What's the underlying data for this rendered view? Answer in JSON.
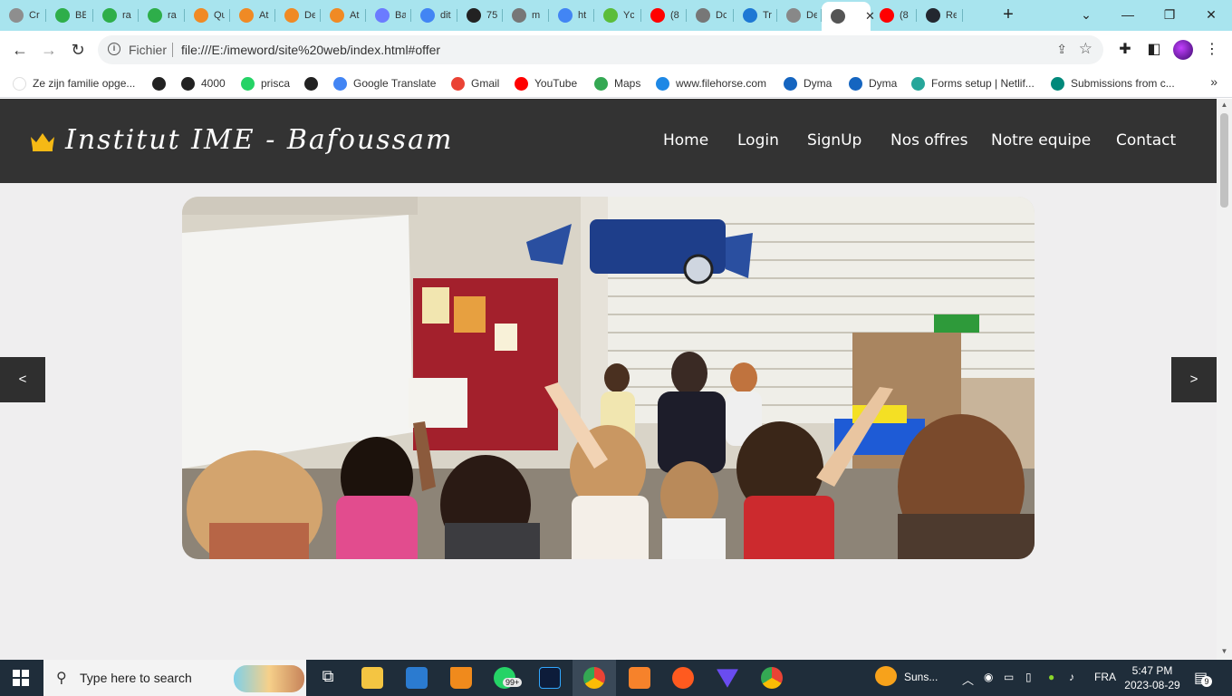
{
  "browser": {
    "tabs": [
      {
        "title": "Cr",
        "color": "#8e8e8e"
      },
      {
        "title": "BE",
        "color": "#2eae4a"
      },
      {
        "title": "ra",
        "color": "#2eae4a"
      },
      {
        "title": "ra",
        "color": "#2eae4a"
      },
      {
        "title": "Qu",
        "color": "#f08a24"
      },
      {
        "title": "At",
        "color": "#f08a24"
      },
      {
        "title": "De",
        "color": "#f08a24"
      },
      {
        "title": "At",
        "color": "#f08a24"
      },
      {
        "title": "Ba",
        "color": "#6b7bff"
      },
      {
        "title": "dit",
        "color": "#4285f4"
      },
      {
        "title": "75",
        "color": "#222222"
      },
      {
        "title": "m",
        "color": "#777777"
      },
      {
        "title": "ht",
        "color": "#4285f4"
      },
      {
        "title": "Yc",
        "color": "#5bbd3a"
      },
      {
        "title": "(8",
        "color": "#ff0000"
      },
      {
        "title": "Dc",
        "color": "#777777"
      },
      {
        "title": "Tr",
        "color": "#1e78d4"
      },
      {
        "title": "De",
        "color": "#888888"
      },
      {
        "title": "De",
        "color": "#555555",
        "active": true
      },
      {
        "title": "(8",
        "color": "#ff0000"
      },
      {
        "title": "Re",
        "color": "#23272f"
      }
    ],
    "new_tab": "+",
    "address": {
      "scheme_label": "Fichier",
      "url": "file:///E:/imeword/site%20web/index.html#offer"
    },
    "bookmarks": [
      {
        "label": "Ze zijn familie opge...",
        "color": "#ffffff"
      },
      {
        "label": "",
        "color": "#222222"
      },
      {
        "label": "4000",
        "color": "#222222"
      },
      {
        "label": "prisca",
        "color": "#25d366"
      },
      {
        "label": "",
        "color": "#222222"
      },
      {
        "label": "Google Translate",
        "color": "#4285f4"
      },
      {
        "label": "Gmail",
        "color": "#ea4335"
      },
      {
        "label": "YouTube",
        "color": "#ff0000"
      },
      {
        "label": "Maps",
        "color": "#34a853"
      },
      {
        "label": "www.filehorse.com",
        "color": "#1e88e5"
      },
      {
        "label": "Dyma",
        "color": "#1565c0"
      },
      {
        "label": "Dyma",
        "color": "#1565c0"
      },
      {
        "label": "Forms setup | Netlif...",
        "color": "#26a69a"
      },
      {
        "label": "Submissions from c...",
        "color": "#00897b"
      }
    ],
    "bookmarks_more": "»"
  },
  "site": {
    "brand": "Institut  IME - Bafoussam",
    "nav": {
      "home": "Home",
      "login": "Login",
      "signup": "SignUp",
      "offers": "Nos offres",
      "team": "Notre equipe",
      "contact": "Contact"
    },
    "slider": {
      "prev": "<",
      "next": ">"
    }
  },
  "taskbar": {
    "search_placeholder": "Type here to search",
    "whatsapp_badge": "99+",
    "weather": "Suns...",
    "language": "FRA",
    "time": "5:47 PM",
    "date": "2023-08-29",
    "notifications": "9"
  }
}
